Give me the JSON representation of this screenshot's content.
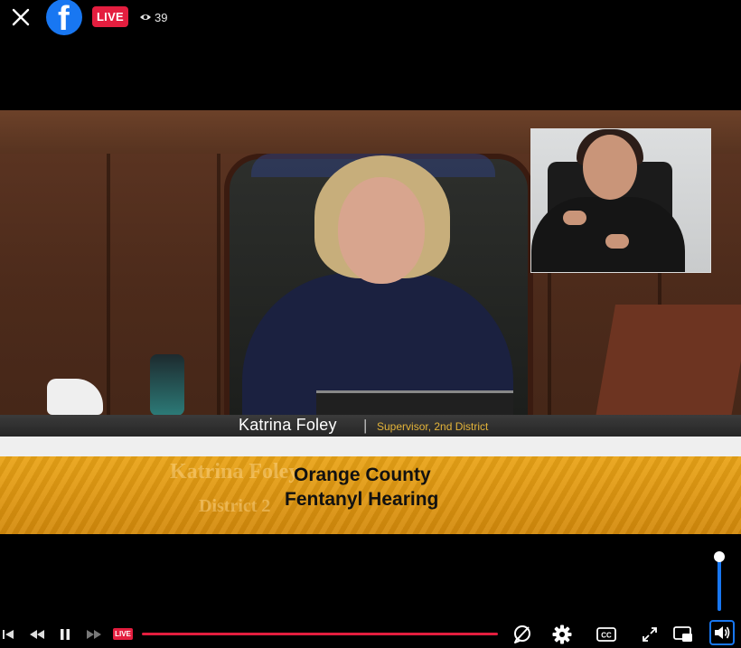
{
  "topbar": {
    "close_icon": "close-icon",
    "logo_letter": "f",
    "live_label": "LIVE",
    "viewer_count": "39",
    "viewer_icon": "eye-icon",
    "brand_color": "#1877f2",
    "live_color": "#e41e3f"
  },
  "video": {
    "lower_third": {
      "name": "Katrina Foley",
      "separator": "|",
      "title": "Supervisor, 2nd District"
    },
    "banner": {
      "background_name": "Katrina Foley",
      "background_district": "District 2",
      "line1": "Orange County",
      "line2": "Fentanyl Hearing"
    }
  },
  "controls": {
    "live_label": "LIVE",
    "icons": [
      "skip-back-icon",
      "rewind-icon",
      "pause-icon",
      "fast-forward-icon",
      "comment-off-icon",
      "settings-gear-icon",
      "closed-captions-icon",
      "fullscreen-icon",
      "picture-in-picture-icon",
      "volume-icon"
    ],
    "cc_label": "CC",
    "volume_level": 1.0
  }
}
